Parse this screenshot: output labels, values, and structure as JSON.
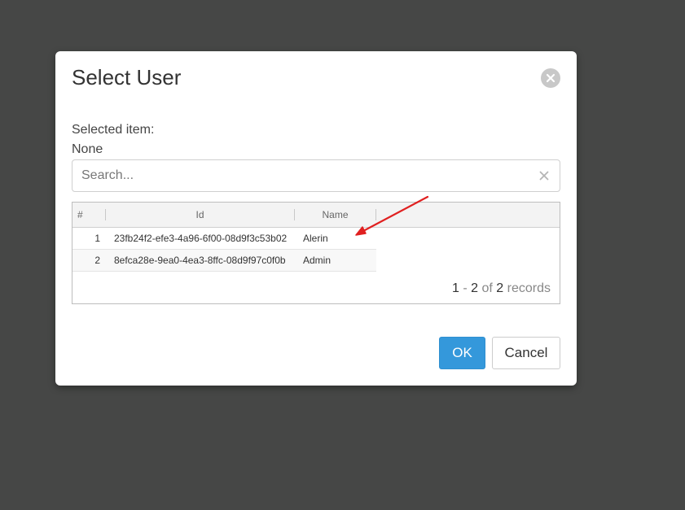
{
  "dialog": {
    "title": "Select User",
    "selected_label": "Selected item:",
    "selected_value": "None",
    "search": {
      "placeholder": "Search...",
      "value": ""
    },
    "grid": {
      "columns": [
        "#",
        "Id",
        "Name"
      ],
      "rows": [
        {
          "index": "1",
          "id": "23fb24f2-efe3-4a96-6f00-08d9f3c53b02",
          "name": "Alerin"
        },
        {
          "index": "2",
          "id": "8efca28e-9ea0-4ea3-8ffc-08d9f97c0f0b",
          "name": "Admin"
        }
      ],
      "pager": {
        "from": "1",
        "sep": "-",
        "to": "2",
        "of": "of",
        "total": "2",
        "records": "records"
      }
    },
    "buttons": {
      "ok": "OK",
      "cancel": "Cancel"
    }
  },
  "colors": {
    "overlay": "#464746",
    "primary": "#3498db",
    "annotation_arrow": "#e02020"
  },
  "icons": {
    "close": "close-circle-icon",
    "search_clear": "clear-x-icon"
  }
}
